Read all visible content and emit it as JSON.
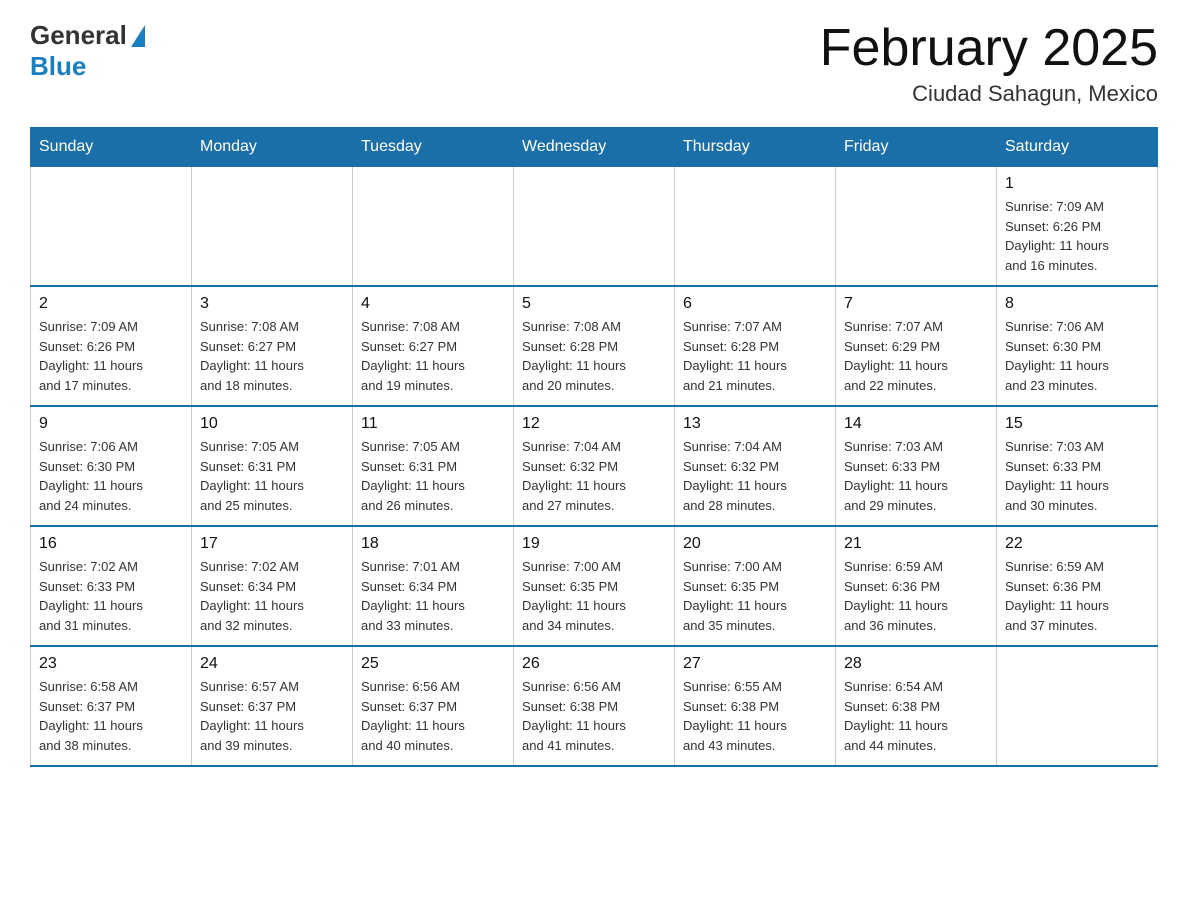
{
  "logo": {
    "general": "General",
    "blue": "Blue"
  },
  "title": "February 2025",
  "subtitle": "Ciudad Sahagun, Mexico",
  "days_of_week": [
    "Sunday",
    "Monday",
    "Tuesday",
    "Wednesday",
    "Thursday",
    "Friday",
    "Saturday"
  ],
  "weeks": [
    [
      {
        "day": "",
        "info": ""
      },
      {
        "day": "",
        "info": ""
      },
      {
        "day": "",
        "info": ""
      },
      {
        "day": "",
        "info": ""
      },
      {
        "day": "",
        "info": ""
      },
      {
        "day": "",
        "info": ""
      },
      {
        "day": "1",
        "info": "Sunrise: 7:09 AM\nSunset: 6:26 PM\nDaylight: 11 hours\nand 16 minutes."
      }
    ],
    [
      {
        "day": "2",
        "info": "Sunrise: 7:09 AM\nSunset: 6:26 PM\nDaylight: 11 hours\nand 17 minutes."
      },
      {
        "day": "3",
        "info": "Sunrise: 7:08 AM\nSunset: 6:27 PM\nDaylight: 11 hours\nand 18 minutes."
      },
      {
        "day": "4",
        "info": "Sunrise: 7:08 AM\nSunset: 6:27 PM\nDaylight: 11 hours\nand 19 minutes."
      },
      {
        "day": "5",
        "info": "Sunrise: 7:08 AM\nSunset: 6:28 PM\nDaylight: 11 hours\nand 20 minutes."
      },
      {
        "day": "6",
        "info": "Sunrise: 7:07 AM\nSunset: 6:28 PM\nDaylight: 11 hours\nand 21 minutes."
      },
      {
        "day": "7",
        "info": "Sunrise: 7:07 AM\nSunset: 6:29 PM\nDaylight: 11 hours\nand 22 minutes."
      },
      {
        "day": "8",
        "info": "Sunrise: 7:06 AM\nSunset: 6:30 PM\nDaylight: 11 hours\nand 23 minutes."
      }
    ],
    [
      {
        "day": "9",
        "info": "Sunrise: 7:06 AM\nSunset: 6:30 PM\nDaylight: 11 hours\nand 24 minutes."
      },
      {
        "day": "10",
        "info": "Sunrise: 7:05 AM\nSunset: 6:31 PM\nDaylight: 11 hours\nand 25 minutes."
      },
      {
        "day": "11",
        "info": "Sunrise: 7:05 AM\nSunset: 6:31 PM\nDaylight: 11 hours\nand 26 minutes."
      },
      {
        "day": "12",
        "info": "Sunrise: 7:04 AM\nSunset: 6:32 PM\nDaylight: 11 hours\nand 27 minutes."
      },
      {
        "day": "13",
        "info": "Sunrise: 7:04 AM\nSunset: 6:32 PM\nDaylight: 11 hours\nand 28 minutes."
      },
      {
        "day": "14",
        "info": "Sunrise: 7:03 AM\nSunset: 6:33 PM\nDaylight: 11 hours\nand 29 minutes."
      },
      {
        "day": "15",
        "info": "Sunrise: 7:03 AM\nSunset: 6:33 PM\nDaylight: 11 hours\nand 30 minutes."
      }
    ],
    [
      {
        "day": "16",
        "info": "Sunrise: 7:02 AM\nSunset: 6:33 PM\nDaylight: 11 hours\nand 31 minutes."
      },
      {
        "day": "17",
        "info": "Sunrise: 7:02 AM\nSunset: 6:34 PM\nDaylight: 11 hours\nand 32 minutes."
      },
      {
        "day": "18",
        "info": "Sunrise: 7:01 AM\nSunset: 6:34 PM\nDaylight: 11 hours\nand 33 minutes."
      },
      {
        "day": "19",
        "info": "Sunrise: 7:00 AM\nSunset: 6:35 PM\nDaylight: 11 hours\nand 34 minutes."
      },
      {
        "day": "20",
        "info": "Sunrise: 7:00 AM\nSunset: 6:35 PM\nDaylight: 11 hours\nand 35 minutes."
      },
      {
        "day": "21",
        "info": "Sunrise: 6:59 AM\nSunset: 6:36 PM\nDaylight: 11 hours\nand 36 minutes."
      },
      {
        "day": "22",
        "info": "Sunrise: 6:59 AM\nSunset: 6:36 PM\nDaylight: 11 hours\nand 37 minutes."
      }
    ],
    [
      {
        "day": "23",
        "info": "Sunrise: 6:58 AM\nSunset: 6:37 PM\nDaylight: 11 hours\nand 38 minutes."
      },
      {
        "day": "24",
        "info": "Sunrise: 6:57 AM\nSunset: 6:37 PM\nDaylight: 11 hours\nand 39 minutes."
      },
      {
        "day": "25",
        "info": "Sunrise: 6:56 AM\nSunset: 6:37 PM\nDaylight: 11 hours\nand 40 minutes."
      },
      {
        "day": "26",
        "info": "Sunrise: 6:56 AM\nSunset: 6:38 PM\nDaylight: 11 hours\nand 41 minutes."
      },
      {
        "day": "27",
        "info": "Sunrise: 6:55 AM\nSunset: 6:38 PM\nDaylight: 11 hours\nand 43 minutes."
      },
      {
        "day": "28",
        "info": "Sunrise: 6:54 AM\nSunset: 6:38 PM\nDaylight: 11 hours\nand 44 minutes."
      },
      {
        "day": "",
        "info": ""
      }
    ]
  ]
}
